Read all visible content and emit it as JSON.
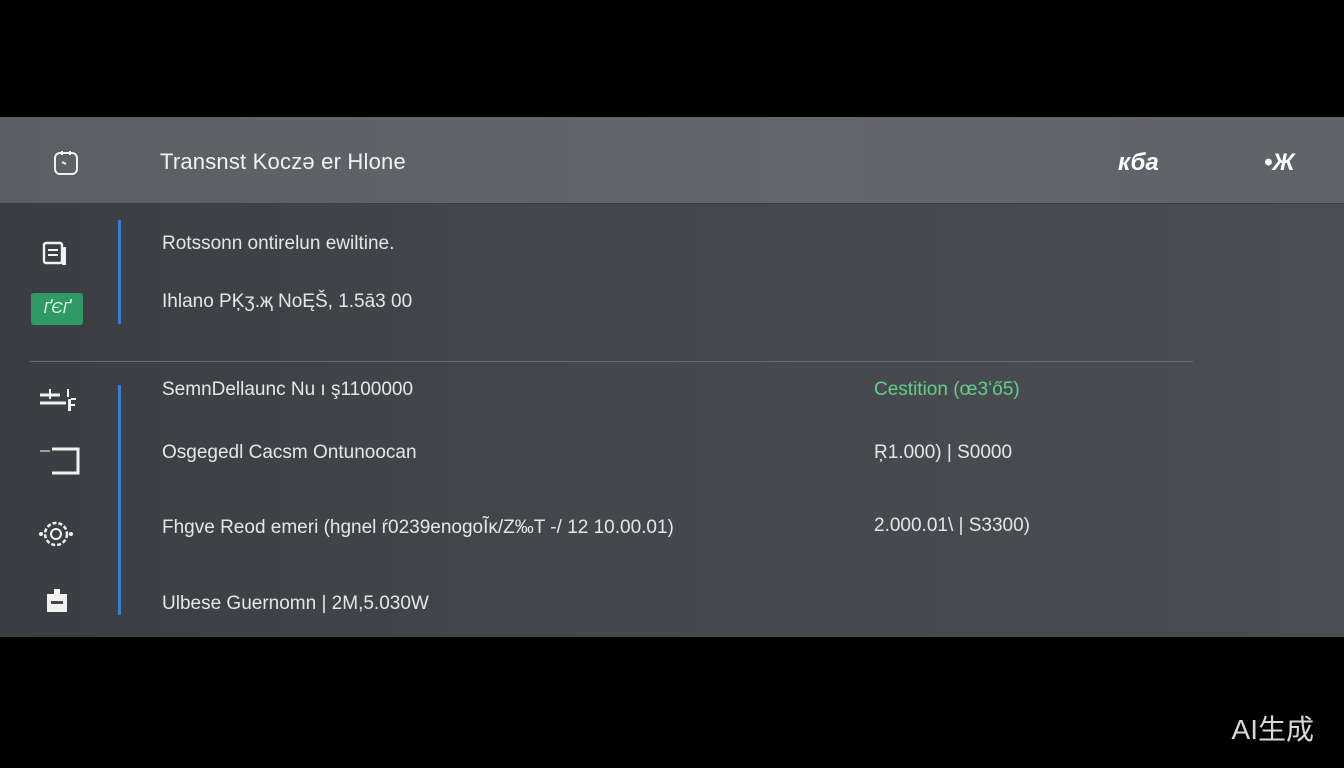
{
  "header": {
    "title": "Transnst Koczə er Hlone",
    "icon": "timer-icon",
    "actions": [
      {
        "label": "кба",
        "icon": "brand-mark-icon"
      },
      {
        "label": "•Ж",
        "icon": "user-mark-icon"
      }
    ]
  },
  "top_section": {
    "line1": "Rotssonn ontirelun ewiltine.",
    "line2": "Ihlano PĶӡ.җ NoĘŠ, 1.5ā3 00",
    "badge": "ҐЄҐ"
  },
  "rows": [
    {
      "label": "SemnDellaunc Nu ı ş1100000",
      "value": "Cestition (œ3ʻő5)",
      "icon": "tools-icon",
      "value_color": "#5fd08a"
    },
    {
      "label": "Osgegedl Cacsm Ontunoocan",
      "value": "Ŗ1.000) | S0000",
      "icon": "square-icon",
      "value_color": "#e6e6e6"
    },
    {
      "label": "Fhgve Reod emeri (hgnel ŕ0239enogoĨĸ/Z‰T -/ 12 10.00.01)",
      "value": "2.000.01\\ | S3300)",
      "icon": "globe-icon",
      "value_color": "#e6e6e6"
    },
    {
      "label": "Ulbese Guernomn | 2M,5.030W",
      "value": "",
      "icon": "battery-icon",
      "value_color": "#e6e6e6"
    }
  ],
  "watermark": "AI生成"
}
